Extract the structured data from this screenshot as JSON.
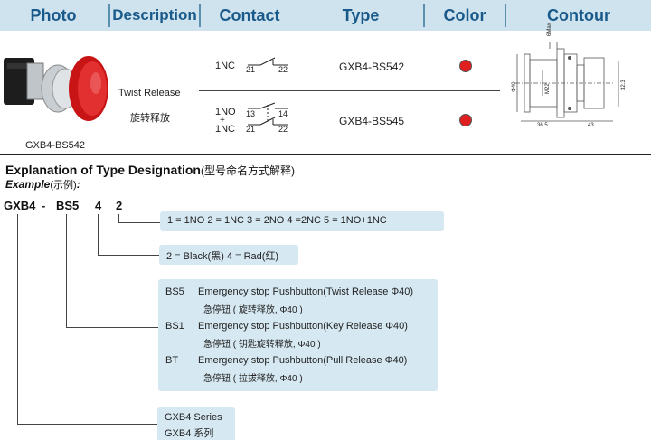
{
  "header": {
    "photo": "Photo",
    "description": "Description",
    "contact": "Contact",
    "type": "Type",
    "color": "Color",
    "contour": "Contour"
  },
  "product": {
    "caption": "GXB4-BS542",
    "desc_en": "Twist Release",
    "desc_cn": "旋转释放",
    "rows": [
      {
        "contact_label": "1NC",
        "terminals": [
          "21",
          "22"
        ],
        "type": "GXB4-BS542",
        "color_hex": "#e02020"
      },
      {
        "contact_label_top": "1NO",
        "contact_plus": "+",
        "contact_label_bottom": "1NC",
        "terminals_top": [
          "13",
          "14"
        ],
        "terminals_bottom": [
          "21",
          "22"
        ],
        "type": "GXB4-BS545",
        "color_hex": "#e02020"
      }
    ],
    "dims": {
      "top": "6Max",
      "dia": "Φ40",
      "thread": "M22",
      "right": "32.3",
      "bottom_left": "36.5",
      "bottom_right": "43"
    }
  },
  "explanation": {
    "title": "Explanation of Type Designation",
    "title_cn": "(型号命名方式解释)",
    "example": "Example",
    "example_cn": "(示例)",
    "example_colon": ":",
    "code_parts": [
      "GXB4",
      "-",
      "BS5",
      "4",
      "2"
    ],
    "box1": "1 = 1NO   2 = 1NC  3 = 2NO 4 =2NC 5 = 1NO+1NC",
    "box2": "2 = Black(黑)   4 = Rad(红)",
    "box3": [
      {
        "code": "BS5",
        "en": "Emergency stop Pushbutton(Twist Release  Φ40)",
        "cn": "急停钮 ( 旋转释放, Φ40 )"
      },
      {
        "code": "BS1",
        "en": "Emergency stop Pushbutton(Key Release    Φ40)",
        "cn": "急停钮 ( 钥匙旋转释放, Φ40 )"
      },
      {
        "code": "BT",
        "en": "Emergency stop Pushbutton(Pull Release   Φ40)",
        "cn": "急停钮 ( 拉拔释放, Φ40 )"
      }
    ],
    "box4_en": "GXB4 Series",
    "box4_cn": "GXB4 系列"
  }
}
